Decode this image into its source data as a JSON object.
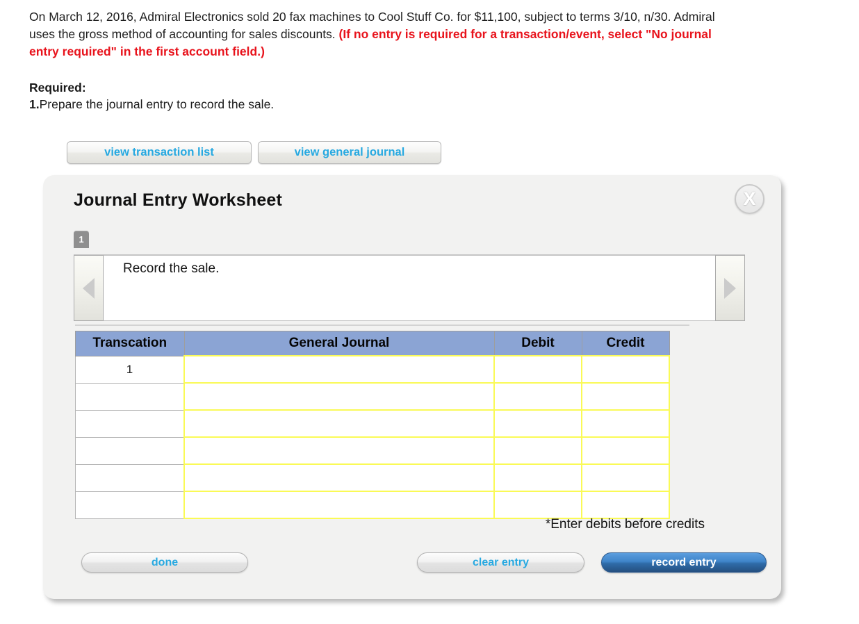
{
  "problem": {
    "text_part1": "On March 12, 2016, Admiral Electronics sold 20 fax machines to Cool Stuff Co. for $11,100, subject to terms 3/10, n/30. Admiral uses the gross method of accounting for sales discounts. ",
    "red_note": "(If no entry is required for a transaction/event, select \"No journal entry required\" in the first account field.)"
  },
  "required": {
    "heading": "Required:",
    "item_number": "1.",
    "item_text": "Prepare the journal entry to record the sale."
  },
  "view_buttons": {
    "transaction_list": "view transaction list",
    "general_journal": "view general journal"
  },
  "worksheet": {
    "title": "Journal Entry Worksheet",
    "close_label": "X",
    "step_tab": "1",
    "prompt": "Record the sale.",
    "prev_arrow": "prev-arrow",
    "next_arrow": "next-arrow",
    "footnote": "*Enter debits before credits"
  },
  "table": {
    "headers": [
      "Transcation",
      "General Journal",
      "Debit",
      "Credit"
    ],
    "rows": [
      {
        "transaction": "1",
        "general_journal": "",
        "debit": "",
        "credit": ""
      },
      {
        "transaction": "",
        "general_journal": "",
        "debit": "",
        "credit": ""
      },
      {
        "transaction": "",
        "general_journal": "",
        "debit": "",
        "credit": ""
      },
      {
        "transaction": "",
        "general_journal": "",
        "debit": "",
        "credit": ""
      },
      {
        "transaction": "",
        "general_journal": "",
        "debit": "",
        "credit": ""
      },
      {
        "transaction": "",
        "general_journal": "",
        "debit": "",
        "credit": ""
      }
    ]
  },
  "footer_buttons": {
    "done": "done",
    "clear_entry": "clear entry",
    "record_entry": "record entry"
  },
  "colors": {
    "red_note": "#e8131c",
    "link_blue": "#27a9e1",
    "table_header_blue": "#8ba4d4",
    "input_cell_yellow": "#fafa56",
    "record_entry_blue": "#3f84c9",
    "panel_background": "#f2f2f1"
  }
}
